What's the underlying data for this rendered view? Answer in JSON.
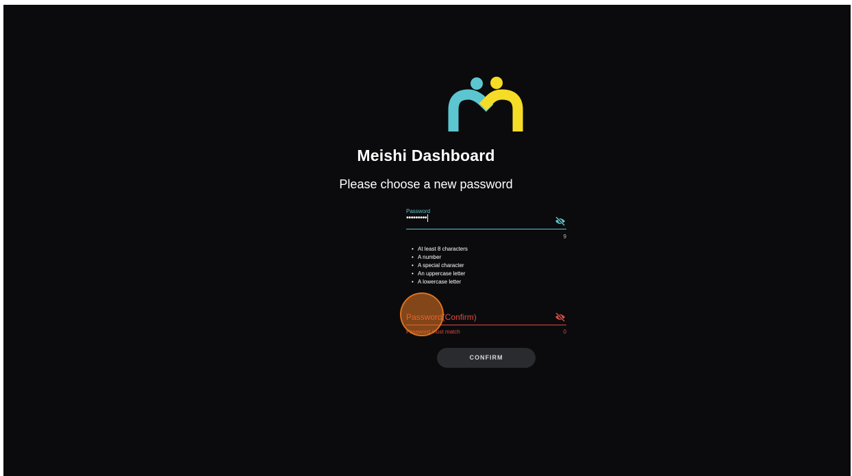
{
  "app": {
    "title": "Meishi Dashboard",
    "subtitle": "Please choose a new password"
  },
  "colors": {
    "background": "#0b0b0d",
    "accent_teal": "#5cc6d0",
    "accent_yellow": "#f5dc26",
    "error_red": "#e24a40",
    "button_bg": "#2a2b2e",
    "touch_indicator": "#e87822"
  },
  "logo": {
    "icon": "meishi-logo-icon"
  },
  "password_field": {
    "label": "Password",
    "value": "•••••••••",
    "counter": "9",
    "visibility_icon": "eye-off-icon"
  },
  "requirements": [
    "At least 8 characters",
    "A number",
    "A special character",
    "An uppercase letter",
    "A lowercase letter"
  ],
  "confirm_field": {
    "label": "Password(Confirm)",
    "error": "Password must match",
    "counter": "0",
    "visibility_icon": "eye-off-icon"
  },
  "actions": {
    "confirm_label": "CONFIRM"
  }
}
